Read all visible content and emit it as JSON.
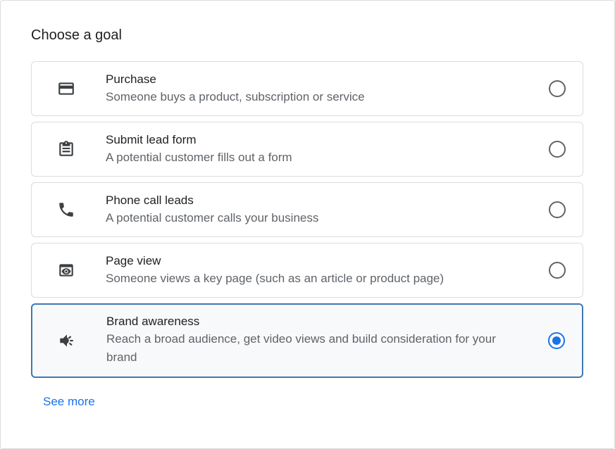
{
  "title": "Choose a goal",
  "options": [
    {
      "title": "Purchase",
      "description": "Someone buys a product, subscription or service",
      "icon": "credit-card-icon",
      "selected": false
    },
    {
      "title": "Submit lead form",
      "description": "A potential customer fills out a form",
      "icon": "clipboard-form-icon",
      "selected": false
    },
    {
      "title": "Phone call leads",
      "description": "A potential customer calls your business",
      "icon": "phone-icon",
      "selected": false
    },
    {
      "title": "Page view",
      "description": "Someone views a key page (such as an article or product page)",
      "icon": "page-view-icon",
      "selected": false
    },
    {
      "title": "Brand awareness",
      "description": "Reach a broad audience, get video views and build consideration for your brand",
      "icon": "megaphone-icon",
      "selected": true
    }
  ],
  "see_more_label": "See more",
  "colors": {
    "accent": "#1a73e8",
    "selected_border": "#3d79b4",
    "border": "#dadce0",
    "text_primary": "#202124",
    "text_secondary": "#5f6368"
  }
}
